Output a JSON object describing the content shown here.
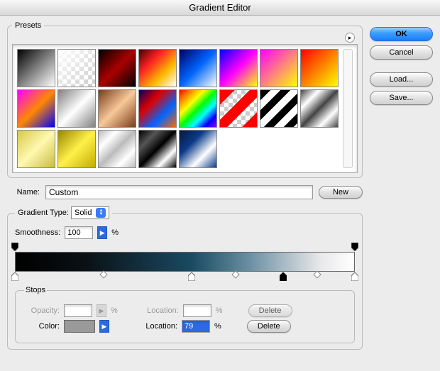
{
  "window": {
    "title": "Gradient Editor"
  },
  "buttons": {
    "ok": "OK",
    "cancel": "Cancel",
    "load": "Load...",
    "save": "Save...",
    "new": "New",
    "delete": "Delete"
  },
  "presets": {
    "legend": "Presets",
    "count": 21
  },
  "name": {
    "label": "Name:",
    "value": "Custom"
  },
  "gradient_type": {
    "label": "Gradient Type:",
    "value": "Solid"
  },
  "smoothness": {
    "label": "Smoothness:",
    "value": "100",
    "unit": "%"
  },
  "gradient_bar": {
    "opacity_stops": [
      {
        "position_pct": 0,
        "opacity": 100
      },
      {
        "position_pct": 100,
        "opacity": 100
      }
    ],
    "color_stops": [
      {
        "position_pct": 0,
        "color": "#000000"
      },
      {
        "position_pct": 52,
        "color": "#1a4a63"
      },
      {
        "position_pct": 79,
        "color": "#9a9a9a",
        "selected": true
      },
      {
        "position_pct": 100,
        "color": "#ffffff"
      }
    ],
    "midpoints_pct": [
      26,
      65,
      89
    ]
  },
  "stops": {
    "legend": "Stops",
    "opacity": {
      "label": "Opacity:",
      "value": "",
      "unit": "%",
      "location_label": "Location:",
      "location_value": "",
      "enabled": false
    },
    "color": {
      "label": "Color:",
      "value_hex": "#9a9a9a",
      "location_label": "Location:",
      "location_value": "79",
      "unit": "%",
      "enabled": true
    }
  }
}
